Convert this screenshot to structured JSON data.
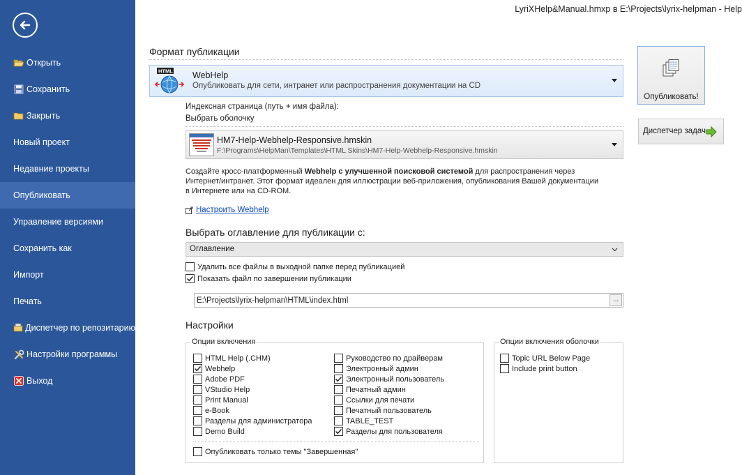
{
  "window_title": "LyriXHelp&Manual.hmxp в E:\\Projects\\lyrix-helpman - Help",
  "sidebar": {
    "items": [
      {
        "label": "Открыть",
        "icon": "folder-open-icon"
      },
      {
        "label": "Сохранить",
        "icon": "floppy-disk-icon"
      },
      {
        "label": "Закрыть",
        "icon": "folder-close-icon"
      },
      {
        "label": "Новый проект"
      },
      {
        "label": "Недавние проекты"
      },
      {
        "label": "Опубликовать",
        "active": true
      },
      {
        "label": "Управление версиями"
      },
      {
        "label": "Сохранить как"
      },
      {
        "label": "Импорт"
      },
      {
        "label": "Печать"
      },
      {
        "label": "Диспетчер по репозитарию",
        "icon": "repository-icon"
      },
      {
        "label": "Настройки программы",
        "icon": "tools-icon"
      },
      {
        "label": "Выход",
        "icon": "exit-icon"
      }
    ]
  },
  "format": {
    "section_title": "Формат публикации",
    "name": "WebHelp",
    "description": "Опубликовать для сети, интранет или распространения документации на CD",
    "icon_badge": "HTML"
  },
  "index_page_label": "Индексная страница (путь + имя файла):",
  "skin": {
    "label": "Выбрать оболочку",
    "name": "HM7-Help-Webhelp-Responsive.hmskin",
    "path": "F:\\Programs\\HelpMan\\Templates\\HTML Skins\\HM7-Help-Webhelp-Responsive.hmskin"
  },
  "description": {
    "p1": "Создайте кросс-платформенный ",
    "b1": "Webhelp с улучшенной поисковой системой",
    "p2": " для распространения через Интернет/интранет. Этот формат идеален для иллюстрации веб-приложения, опубликования Вашей документации в Интернете или на CD-ROM."
  },
  "configure_link": "Настроить Webhelp",
  "toc": {
    "title": "Выбрать оглавление для публикации с:",
    "selected": "Оглавление"
  },
  "options": {
    "delete_files": {
      "label": "Удалить все файлы в выходной папке перед публикацией",
      "checked": false
    },
    "show_file": {
      "label": "Показать файл по завершении публикации",
      "checked": true
    }
  },
  "output_path": "E:\\Projects\\lyrix-helpman\\HTML\\index.html",
  "browse_label": "...",
  "settings": {
    "title": "Настройки",
    "include_options_title": "Опции включения",
    "col1": [
      {
        "label": "HTML Help (.CHM)",
        "checked": false
      },
      {
        "label": "Webhelp",
        "checked": true
      },
      {
        "label": "Adobe PDF",
        "checked": false
      },
      {
        "label": "VStudio Help",
        "checked": false
      },
      {
        "label": "Print Manual",
        "checked": false
      },
      {
        "label": "e-Book",
        "checked": false
      },
      {
        "label": "Разделы для администратора",
        "checked": false
      },
      {
        "label": "Demo Build",
        "checked": false
      }
    ],
    "col2": [
      {
        "label": "Руководство по драйверам",
        "checked": false
      },
      {
        "label": "Электронный админ",
        "checked": false
      },
      {
        "label": "Электронный пользователь",
        "checked": true
      },
      {
        "label": "Печатный админ",
        "checked": false
      },
      {
        "label": "Ссылки для печати",
        "checked": false
      },
      {
        "label": "Печатный пользователь",
        "checked": false
      },
      {
        "label": "TABLE_TEST",
        "checked": false
      },
      {
        "label": "Разделы для пользователя",
        "checked": true
      }
    ],
    "only_completed": {
      "label": "Опубликовать только темы \"Завершенная\"",
      "checked": false
    },
    "skin_options_title": "Опции включения оболочки",
    "skin_options": [
      {
        "label": "Topic URL Below Page",
        "checked": false
      },
      {
        "label": "Include print button",
        "checked": false
      }
    ]
  },
  "buttons": {
    "publish": "Опубликовать!",
    "task_manager": "Диспетчер задач"
  },
  "colors": {
    "sidebar_bg": "#2b579a",
    "sidebar_active": "#3f6ab0",
    "link": "#0a48c2"
  }
}
